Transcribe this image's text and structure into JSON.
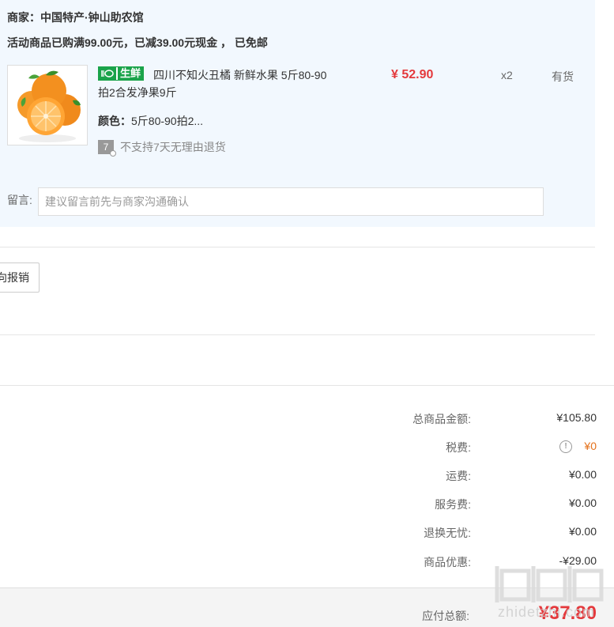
{
  "shop": {
    "name": "商家：中国特产·钟山助农馆",
    "promo": "活动商品已购满99.00元，已减39.00元现金 ， 已免邮"
  },
  "product": {
    "badge_text": "生鲜",
    "title": "四川不知火丑橘 新鲜水果 5斤80-90拍2合发净果9斤",
    "spec_label": "颜色：",
    "spec_value": "5斤80-90拍2...",
    "return_icon_text": "7",
    "return_note": "不支持7天无理由退货",
    "price": "¥ 52.90",
    "qty": "x2",
    "stock": "有货"
  },
  "note": {
    "label": "留言:",
    "placeholder": "建议留言前先与商家沟通确认"
  },
  "invoice": {
    "button_label": "向报销"
  },
  "summary": [
    {
      "label": "总商品金额:",
      "value": "¥105.80"
    },
    {
      "label": "税费:",
      "value": "¥0"
    },
    {
      "label": "运费:",
      "value": "¥0.00"
    },
    {
      "label": "服务费:",
      "value": "¥0.00"
    },
    {
      "label": "退换无忧:",
      "value": "¥0.00"
    },
    {
      "label": "商品优惠:",
      "value": "-¥29.00"
    }
  ],
  "total": {
    "label": "应付总额:",
    "value": "¥37.80"
  },
  "watermark": {
    "text": "zhidetzhi.com"
  },
  "colors": {
    "price_red": "#e4393c",
    "tax_orange": "#e4711b",
    "fresh_green": "#1aa34a",
    "panel_bg": "#f2f8fe"
  }
}
